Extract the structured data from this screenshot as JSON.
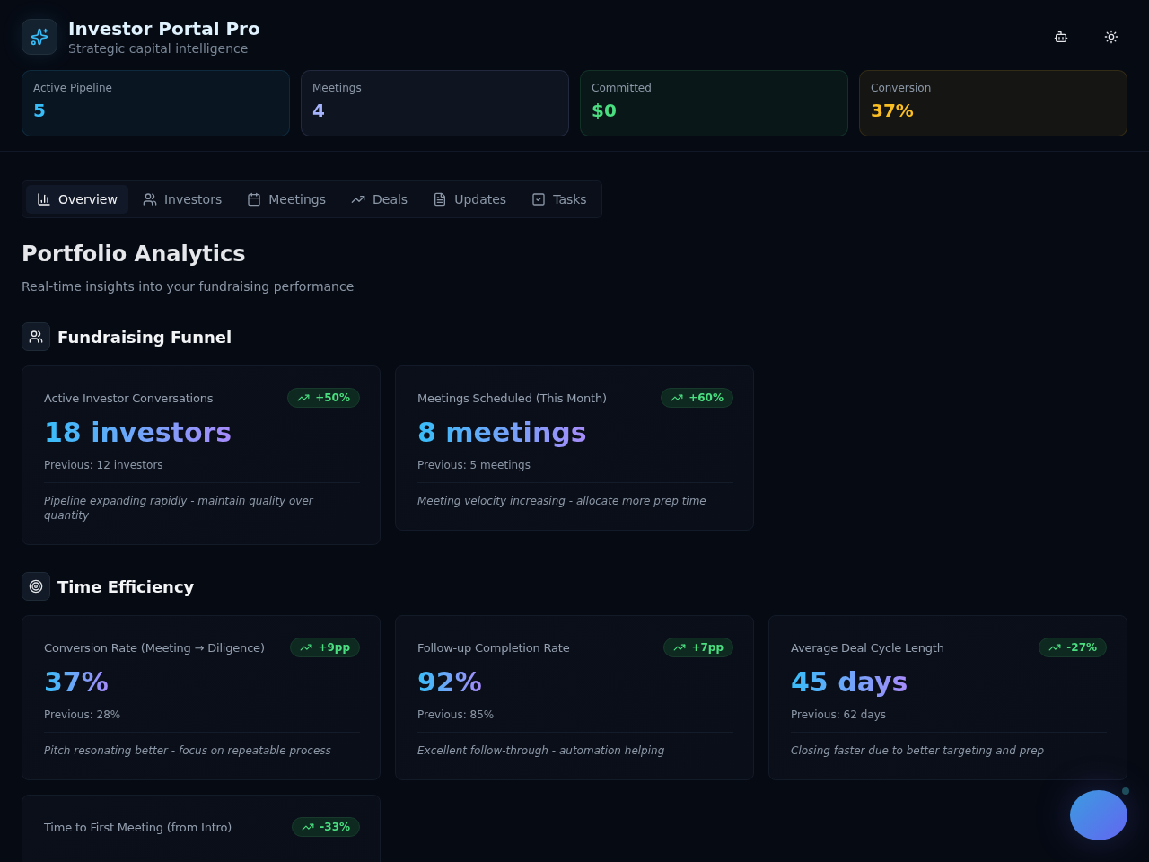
{
  "header": {
    "title": "Investor Portal Pro",
    "subtitle": "Strategic capital intelligence"
  },
  "stats": [
    {
      "label": "Active Pipeline",
      "value": "5",
      "color": "#38bdf8"
    },
    {
      "label": "Meetings",
      "value": "4",
      "color": "#a5b4fc"
    },
    {
      "label": "Committed",
      "value": "$0",
      "color": "#4ade80"
    },
    {
      "label": "Conversion",
      "value": "37%",
      "color": "#fbbf24"
    }
  ],
  "tabs": [
    {
      "label": "Overview",
      "selected": true
    },
    {
      "label": "Investors",
      "selected": false
    },
    {
      "label": "Meetings",
      "selected": false
    },
    {
      "label": "Deals",
      "selected": false
    },
    {
      "label": "Updates",
      "selected": false
    },
    {
      "label": "Tasks",
      "selected": false
    }
  ],
  "page": {
    "title": "Portfolio Analytics",
    "subtitle": "Real-time insights into your fundraising performance"
  },
  "sections": [
    {
      "title": "Fundraising Funnel",
      "metrics": [
        {
          "label": "Active Investor Conversations",
          "trend": "+50%",
          "value": "18 investors",
          "previous": "Previous: 12 investors",
          "note": "Pipeline expanding rapidly - maintain quality over quantity"
        },
        {
          "label": "Meetings Scheduled (This Month)",
          "trend": "+60%",
          "value": "8 meetings",
          "previous": "Previous: 5 meetings",
          "note": "Meeting velocity increasing - allocate more prep time"
        }
      ]
    },
    {
      "title": "Time Efficiency",
      "metrics": [
        {
          "label": "Conversion Rate (Meeting → Diligence)",
          "trend": "+9pp",
          "value": "37%",
          "previous": "Previous: 28%",
          "note": "Pitch resonating better - focus on repeatable process"
        },
        {
          "label": "Follow-up Completion Rate",
          "trend": "+7pp",
          "value": "92%",
          "previous": "Previous: 85%",
          "note": "Excellent follow-through - automation helping"
        },
        {
          "label": "Average Deal Cycle Length",
          "trend": "-27%",
          "value": "45 days",
          "previous": "Previous: 62 days",
          "note": "Closing faster due to better targeting and prep"
        },
        {
          "label": "Time to First Meeting (from Intro)",
          "trend": "-33%"
        }
      ]
    }
  ]
}
